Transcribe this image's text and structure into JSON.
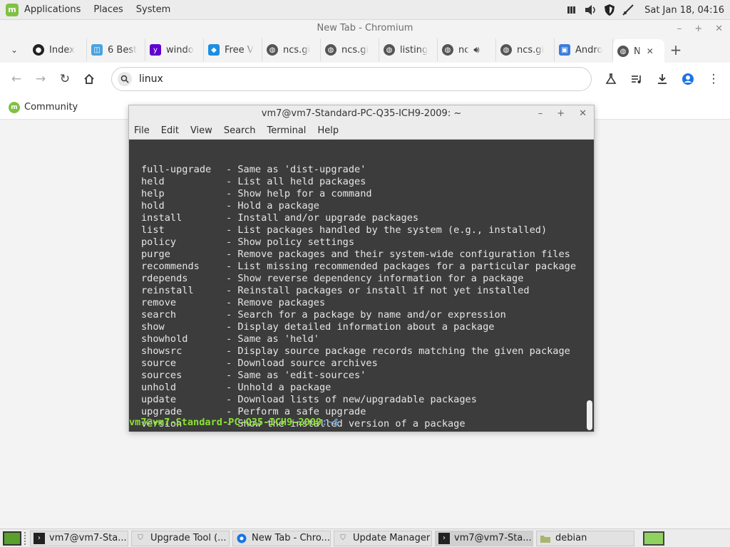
{
  "top_panel": {
    "menu": [
      "Applications",
      "Places",
      "System"
    ],
    "clock": "Sat Jan 18, 04:16"
  },
  "chromium": {
    "title": "New Tab - Chromium",
    "tabs": [
      {
        "label": "Index",
        "icon": "github-icon"
      },
      {
        "label": "6 Best",
        "icon": "blog-icon"
      },
      {
        "label": "windo",
        "icon": "yahoo-icon"
      },
      {
        "label": "Free V",
        "icon": "puzzle-icon"
      },
      {
        "label": "ncs.gi",
        "icon": "globe-icon"
      },
      {
        "label": "ncs.gi",
        "icon": "globe-icon"
      },
      {
        "label": "listing",
        "icon": "globe-icon"
      },
      {
        "label": "nc",
        "icon": "globe-icon"
      },
      {
        "label": "ncs.gi",
        "icon": "globe-icon"
      },
      {
        "label": "Andro",
        "icon": "android-icon"
      },
      {
        "label": "N",
        "icon": "globe-icon"
      }
    ],
    "omnibox_text": "linux",
    "bookmark": "Community"
  },
  "terminal": {
    "title": "vm7@vm7-Standard-PC-Q35-ICH9-2009: ~",
    "menu": [
      "File",
      "Edit",
      "View",
      "Search",
      "Terminal",
      "Help"
    ],
    "commands": [
      {
        "name": "full-upgrade",
        "desc": "- Same as 'dist-upgrade'"
      },
      {
        "name": "held",
        "desc": "- List all held packages"
      },
      {
        "name": "help",
        "desc": "- Show help for a command"
      },
      {
        "name": "hold",
        "desc": "- Hold a package"
      },
      {
        "name": "install",
        "desc": "- Install and/or upgrade packages"
      },
      {
        "name": "list",
        "desc": "- List packages handled by the system (e.g., installed)"
      },
      {
        "name": "policy",
        "desc": "- Show policy settings"
      },
      {
        "name": "purge",
        "desc": "- Remove packages and their system-wide configuration files"
      },
      {
        "name": "recommends",
        "desc": "- List missing recommended packages for a particular package"
      },
      {
        "name": "rdepends",
        "desc": "- Show reverse dependency information for a package"
      },
      {
        "name": "reinstall",
        "desc": "- Reinstall packages or install if not yet installed"
      },
      {
        "name": "remove",
        "desc": "- Remove packages"
      },
      {
        "name": "search",
        "desc": "- Search for a package by name and/or expression"
      },
      {
        "name": "show",
        "desc": "- Display detailed information about a package"
      },
      {
        "name": "showhold",
        "desc": "- Same as 'held'"
      },
      {
        "name": "showsrc",
        "desc": "- Display source package records matching the given package"
      },
      {
        "name": "source",
        "desc": "- Download source archives"
      },
      {
        "name": "sources",
        "desc": "- Same as 'edit-sources'"
      },
      {
        "name": "unhold",
        "desc": "- Unhold a package"
      },
      {
        "name": "update",
        "desc": "- Download lists of new/upgradable packages"
      },
      {
        "name": "upgrade",
        "desc": "- Perform a safe upgrade"
      },
      {
        "name": "version",
        "desc": "- Show the installed version of a package"
      }
    ],
    "prompt_user": "vm7@vm7-Standard-PC-Q35-ICH9-2009",
    "prompt_path": ":~$"
  },
  "taskbar": {
    "tasks": [
      {
        "label": "vm7@vm7-Sta...",
        "icon": "terminal-icon"
      },
      {
        "label": "Upgrade Tool (...",
        "icon": "shield-icon"
      },
      {
        "label": "New Tab - Chro...",
        "icon": "chromium-icon"
      },
      {
        "label": "Update Manager",
        "icon": "shield-icon"
      },
      {
        "label": "vm7@vm7-Sta...",
        "icon": "terminal-icon"
      },
      {
        "label": "debian",
        "icon": "folder-icon"
      }
    ]
  }
}
